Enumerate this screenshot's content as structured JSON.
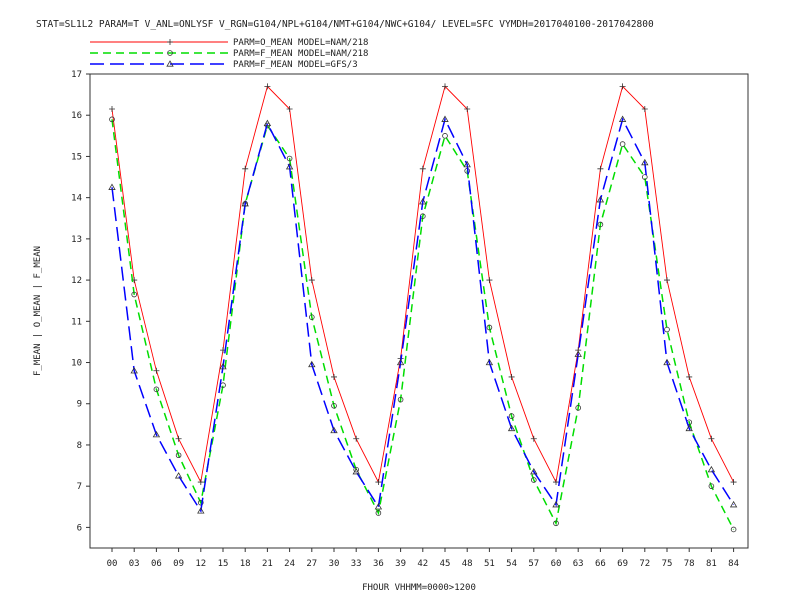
{
  "header": {
    "title": "STAT=SL1L2 PARAM=T V_ANL=ONLYSF V_RGN=G104/NPL+G104/NMT+G104/NWC+G104/ LEVEL=SFC VYMDH=2017040100-2017042800"
  },
  "chart_data": {
    "type": "line",
    "title": "STAT=SL1L2 PARAM=T V_ANL=ONLYSF V_RGN=G104/NPL+G104/NMT+G104/NWC+G104/ LEVEL=SFC VYMDH=2017040100-2017042800",
    "xlabel": "FHOUR VHHMM=0000>1200",
    "ylabel": "F_MEAN | O_MEAN | F_MEAN",
    "categories": [
      "00",
      "03",
      "06",
      "09",
      "12",
      "15",
      "18",
      "21",
      "24",
      "27",
      "30",
      "33",
      "36",
      "39",
      "42",
      "45",
      "48",
      "51",
      "54",
      "57",
      "60",
      "63",
      "66",
      "69",
      "72",
      "75",
      "78",
      "81",
      "84"
    ],
    "ylim": [
      5.5,
      17
    ],
    "yticks": [
      6,
      7,
      8,
      9,
      10,
      11,
      12,
      13,
      14,
      15,
      16,
      17
    ],
    "grid": false,
    "legend_position": "top-left",
    "series": [
      {
        "name": "PARM=O_MEAN MODEL=NAM/218",
        "color": "#ff0000",
        "dash": "solid",
        "marker": "plus",
        "values": [
          16.15,
          12.0,
          9.8,
          8.15,
          7.1,
          10.3,
          14.7,
          16.7,
          16.15,
          12.0,
          9.65,
          8.15,
          7.1,
          10.1,
          14.7,
          16.7,
          16.15,
          12.0,
          9.65,
          8.15,
          7.1,
          10.3,
          14.7,
          16.7,
          16.15,
          12.0,
          9.65,
          8.15,
          7.1
        ]
      },
      {
        "name": "PARM=F_MEAN MODEL=NAM/218",
        "color": "#00dd00",
        "dash": "dashed",
        "marker": "diamond",
        "values": [
          15.9,
          11.65,
          9.35,
          7.75,
          6.6,
          9.45,
          13.85,
          15.75,
          14.95,
          11.1,
          8.95,
          7.4,
          6.35,
          9.1,
          13.55,
          15.5,
          14.65,
          10.85,
          8.7,
          7.15,
          6.1,
          8.9,
          13.35,
          15.3,
          14.5,
          10.8,
          8.55,
          7.0,
          5.95
        ]
      },
      {
        "name": "PARM=F_MEAN MODEL=GFS/3",
        "color": "#0000ff",
        "dash": "longdash",
        "marker": "triangle",
        "values": [
          14.25,
          9.8,
          8.25,
          7.25,
          6.4,
          9.9,
          13.85,
          15.8,
          14.75,
          9.95,
          8.35,
          7.35,
          6.5,
          10.0,
          13.9,
          15.9,
          14.8,
          10.0,
          8.4,
          7.35,
          6.55,
          10.2,
          13.95,
          15.9,
          14.85,
          10.0,
          8.4,
          7.4,
          6.55
        ]
      }
    ]
  }
}
